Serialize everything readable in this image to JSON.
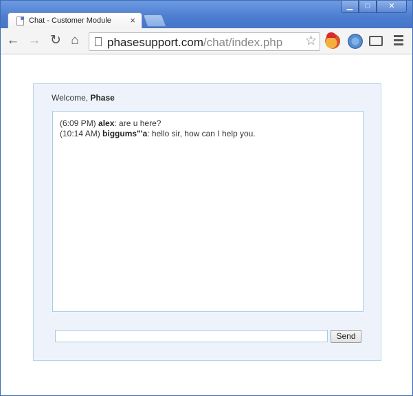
{
  "browser": {
    "tab_title": "Chat - Customer Module",
    "tab_close": "×",
    "url_host": "phasesupport.com",
    "url_path": "/chat/index.php",
    "window_buttons": {
      "minimize": "▁",
      "maximize": "□",
      "close": "✕"
    },
    "icons": [
      "back-arrow-icon",
      "forward-arrow-icon",
      "reload-icon",
      "home-icon",
      "page-icon",
      "star-icon",
      "extension-icon",
      "extension-icon",
      "cast-icon",
      "menu-icon"
    ]
  },
  "chat": {
    "welcome_prefix": "Welcome, ",
    "welcome_name": "Phase",
    "messages": [
      {
        "time": "(6:09 PM)",
        "user": "alex",
        "text": ": are u here?"
      },
      {
        "time": "(10:14 AM)",
        "user": "biggums\"'a",
        "text": ": hello sir, how can I help you."
      }
    ],
    "input_value": "",
    "send_label": "Send"
  },
  "colors": {
    "titlebar": "#4c7ccf",
    "panel_bg": "#eef3fb",
    "panel_border": "#b9d4ea"
  }
}
